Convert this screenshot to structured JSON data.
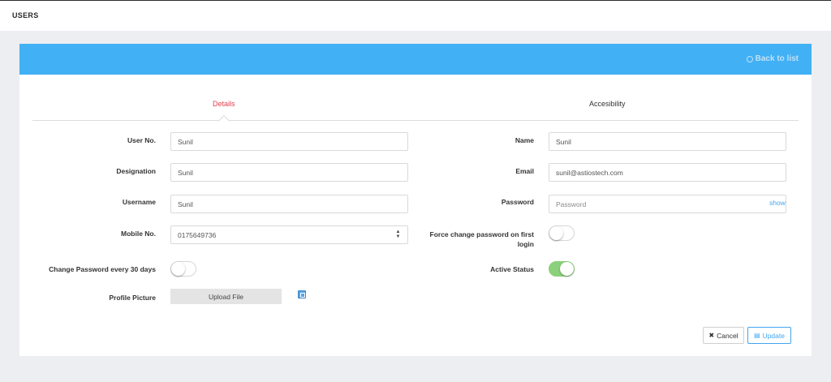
{
  "page": {
    "title": "USERS"
  },
  "header": {
    "back_label": "Back to list"
  },
  "tabs": [
    {
      "label": "Details",
      "active": true
    },
    {
      "label": "Accesibility",
      "active": false
    }
  ],
  "form": {
    "user_no": {
      "label": "User No.",
      "value": "Sunil"
    },
    "designation": {
      "label": "Designation",
      "value": "Sunil"
    },
    "username": {
      "label": "Username",
      "value": "Sunil"
    },
    "mobile_no": {
      "label": "Mobile No.",
      "value": "0175649736"
    },
    "change_password_30": {
      "label": "Change Password every 30 days",
      "on": false
    },
    "profile_picture": {
      "label": "Profile Picture",
      "button": "Upload File",
      "icon": "file-image-icon"
    },
    "name": {
      "label": "Name",
      "value": "Sunil"
    },
    "email": {
      "label": "Email",
      "value": "sunil@astiostech.com"
    },
    "password": {
      "label": "Password",
      "placeholder": "Password",
      "show_label": "show"
    },
    "force_change": {
      "label_line1": "Force change password on first",
      "label_line2": "login",
      "on": false
    },
    "active_status": {
      "label": "Active Status",
      "on": true
    }
  },
  "actions": {
    "cancel_label": "Cancel",
    "cancel_icon": "times-icon",
    "update_label": "Update",
    "update_icon": "save-icon"
  },
  "colors": {
    "header": "#42b0f4",
    "active_tab": "#e0404e",
    "toggle_on": "#8bd07a",
    "link": "#42a5f0"
  }
}
